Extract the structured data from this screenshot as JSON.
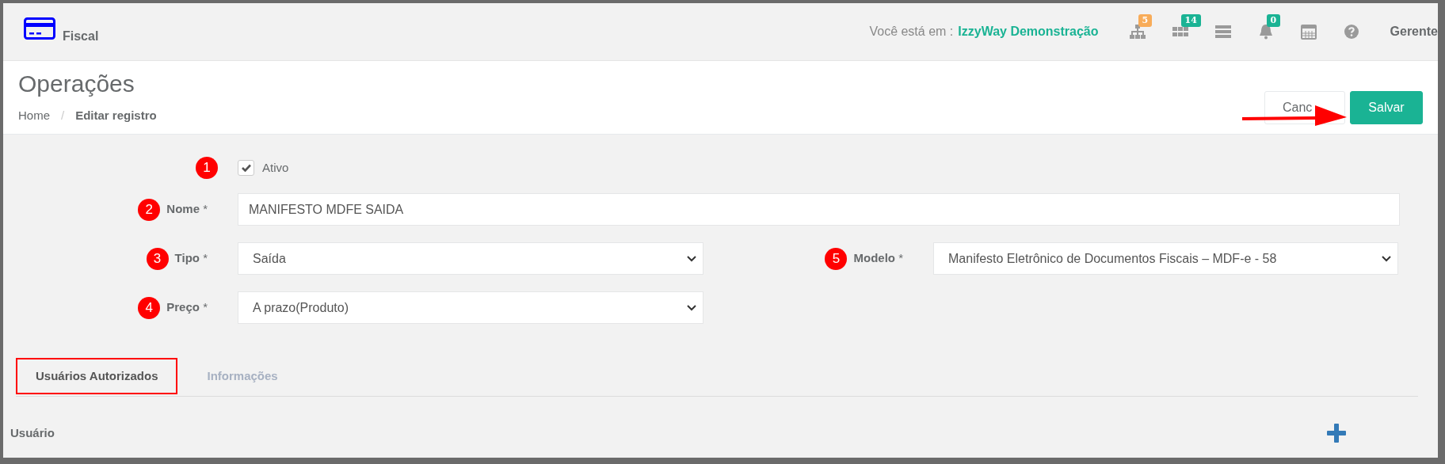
{
  "module": {
    "title": "Fiscal"
  },
  "topbar": {
    "context_label": "Você está em :",
    "company": "IzzyWay Demonstração",
    "user": "Gerente",
    "icons": [
      {
        "kind": "sitemap",
        "badge": "5",
        "color": "#f8ac59"
      },
      {
        "kind": "grid",
        "badge": "14",
        "color": "#1ab394"
      },
      {
        "kind": "server"
      },
      {
        "kind": "bell",
        "badge": "0",
        "color": "#1ab394"
      },
      {
        "kind": "calendar"
      },
      {
        "kind": "help"
      }
    ]
  },
  "page": {
    "title": "Operações",
    "breadcrumb_separator": "/",
    "breadcrumb": [
      {
        "label": "Home",
        "current": false
      },
      {
        "label": "Editar registro",
        "current": true
      }
    ]
  },
  "buttons": [
    {
      "label": "Canc",
      "kind": "secondary"
    },
    {
      "label": "Salvar",
      "kind": "primary"
    }
  ],
  "annotation_arrow": true,
  "form": {
    "active": {
      "label": "Ativo",
      "checked": true,
      "marker": "1"
    },
    "rows": [
      [
        {
          "label": "**Nome** *",
          "kind": "input",
          "value": "MANIFESTO MDFE SAIDA",
          "marker": "2"
        }
      ],
      [
        {
          "label": "**Tipo** *",
          "kind": "select",
          "value": "Saída",
          "marker": "3"
        },
        {
          "label": "**Modelo** *",
          "kind": "select",
          "value": "Manifesto Eletrônico de Documentos Fiscais – MDF-e - 58",
          "marker": "5"
        }
      ],
      [
        {
          "label": "**Preço** *",
          "kind": "select",
          "value": "A prazo(Produto)",
          "marker": "4"
        }
      ]
    ]
  },
  "tabs": [
    {
      "label": "Usuários Autorizados",
      "selected": true,
      "highlighted": true
    },
    {
      "label": "Informações",
      "selected": false,
      "highlighted": false
    }
  ],
  "table": {
    "columns": [
      "Usuário"
    ]
  }
}
